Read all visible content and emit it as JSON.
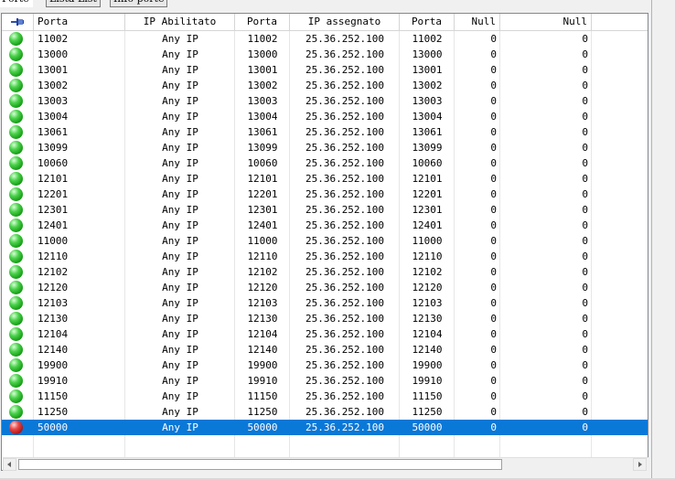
{
  "tabs": [
    {
      "label": "Porte",
      "selected": true
    },
    {
      "label": "Lista List",
      "selected": false
    },
    {
      "label": "Info porte",
      "selected": false
    }
  ],
  "columns": [
    {
      "key": "status",
      "label": ""
    },
    {
      "key": "porta",
      "label": "Porta"
    },
    {
      "key": "ip_abilitato",
      "label": "IP Abilitato"
    },
    {
      "key": "porta2",
      "label": "Porta"
    },
    {
      "key": "ip_assegnato",
      "label": "IP assegnato"
    },
    {
      "key": "porta3",
      "label": "Porta"
    },
    {
      "key": "null1",
      "label": "Null"
    },
    {
      "key": "null2",
      "label": "Null"
    }
  ],
  "header_icon": "pin-icon",
  "status_colors": {
    "active": "#1fb31f",
    "inactive": "#d01818"
  },
  "selection_color": "#0a78d7",
  "rows": [
    {
      "status": "active",
      "porta": "11002",
      "ip_abilitato": "Any IP",
      "porta2": "11002",
      "ip_assegnato": "25.36.252.100",
      "porta3": "11002",
      "null1": "0",
      "null2": "0"
    },
    {
      "status": "active",
      "porta": "13000",
      "ip_abilitato": "Any IP",
      "porta2": "13000",
      "ip_assegnato": "25.36.252.100",
      "porta3": "13000",
      "null1": "0",
      "null2": "0"
    },
    {
      "status": "active",
      "porta": "13001",
      "ip_abilitato": "Any IP",
      "porta2": "13001",
      "ip_assegnato": "25.36.252.100",
      "porta3": "13001",
      "null1": "0",
      "null2": "0"
    },
    {
      "status": "active",
      "porta": "13002",
      "ip_abilitato": "Any IP",
      "porta2": "13002",
      "ip_assegnato": "25.36.252.100",
      "porta3": "13002",
      "null1": "0",
      "null2": "0"
    },
    {
      "status": "active",
      "porta": "13003",
      "ip_abilitato": "Any IP",
      "porta2": "13003",
      "ip_assegnato": "25.36.252.100",
      "porta3": "13003",
      "null1": "0",
      "null2": "0"
    },
    {
      "status": "active",
      "porta": "13004",
      "ip_abilitato": "Any IP",
      "porta2": "13004",
      "ip_assegnato": "25.36.252.100",
      "porta3": "13004",
      "null1": "0",
      "null2": "0"
    },
    {
      "status": "active",
      "porta": "13061",
      "ip_abilitato": "Any IP",
      "porta2": "13061",
      "ip_assegnato": "25.36.252.100",
      "porta3": "13061",
      "null1": "0",
      "null2": "0"
    },
    {
      "status": "active",
      "porta": "13099",
      "ip_abilitato": "Any IP",
      "porta2": "13099",
      "ip_assegnato": "25.36.252.100",
      "porta3": "13099",
      "null1": "0",
      "null2": "0"
    },
    {
      "status": "active",
      "porta": "10060",
      "ip_abilitato": "Any IP",
      "porta2": "10060",
      "ip_assegnato": "25.36.252.100",
      "porta3": "10060",
      "null1": "0",
      "null2": "0"
    },
    {
      "status": "active",
      "porta": "12101",
      "ip_abilitato": "Any IP",
      "porta2": "12101",
      "ip_assegnato": "25.36.252.100",
      "porta3": "12101",
      "null1": "0",
      "null2": "0"
    },
    {
      "status": "active",
      "porta": "12201",
      "ip_abilitato": "Any IP",
      "porta2": "12201",
      "ip_assegnato": "25.36.252.100",
      "porta3": "12201",
      "null1": "0",
      "null2": "0"
    },
    {
      "status": "active",
      "porta": "12301",
      "ip_abilitato": "Any IP",
      "porta2": "12301",
      "ip_assegnato": "25.36.252.100",
      "porta3": "12301",
      "null1": "0",
      "null2": "0"
    },
    {
      "status": "active",
      "porta": "12401",
      "ip_abilitato": "Any IP",
      "porta2": "12401",
      "ip_assegnato": "25.36.252.100",
      "porta3": "12401",
      "null1": "0",
      "null2": "0"
    },
    {
      "status": "active",
      "porta": "11000",
      "ip_abilitato": "Any IP",
      "porta2": "11000",
      "ip_assegnato": "25.36.252.100",
      "porta3": "11000",
      "null1": "0",
      "null2": "0"
    },
    {
      "status": "active",
      "porta": "12110",
      "ip_abilitato": "Any IP",
      "porta2": "12110",
      "ip_assegnato": "25.36.252.100",
      "porta3": "12110",
      "null1": "0",
      "null2": "0"
    },
    {
      "status": "active",
      "porta": "12102",
      "ip_abilitato": "Any IP",
      "porta2": "12102",
      "ip_assegnato": "25.36.252.100",
      "porta3": "12102",
      "null1": "0",
      "null2": "0"
    },
    {
      "status": "active",
      "porta": "12120",
      "ip_abilitato": "Any IP",
      "porta2": "12120",
      "ip_assegnato": "25.36.252.100",
      "porta3": "12120",
      "null1": "0",
      "null2": "0"
    },
    {
      "status": "active",
      "porta": "12103",
      "ip_abilitato": "Any IP",
      "porta2": "12103",
      "ip_assegnato": "25.36.252.100",
      "porta3": "12103",
      "null1": "0",
      "null2": "0"
    },
    {
      "status": "active",
      "porta": "12130",
      "ip_abilitato": "Any IP",
      "porta2": "12130",
      "ip_assegnato": "25.36.252.100",
      "porta3": "12130",
      "null1": "0",
      "null2": "0"
    },
    {
      "status": "active",
      "porta": "12104",
      "ip_abilitato": "Any IP",
      "porta2": "12104",
      "ip_assegnato": "25.36.252.100",
      "porta3": "12104",
      "null1": "0",
      "null2": "0"
    },
    {
      "status": "active",
      "porta": "12140",
      "ip_abilitato": "Any IP",
      "porta2": "12140",
      "ip_assegnato": "25.36.252.100",
      "porta3": "12140",
      "null1": "0",
      "null2": "0"
    },
    {
      "status": "active",
      "porta": "19900",
      "ip_abilitato": "Any IP",
      "porta2": "19900",
      "ip_assegnato": "25.36.252.100",
      "porta3": "19900",
      "null1": "0",
      "null2": "0"
    },
    {
      "status": "active",
      "porta": "19910",
      "ip_abilitato": "Any IP",
      "porta2": "19910",
      "ip_assegnato": "25.36.252.100",
      "porta3": "19910",
      "null1": "0",
      "null2": "0"
    },
    {
      "status": "active",
      "porta": "11150",
      "ip_abilitato": "Any IP",
      "porta2": "11150",
      "ip_assegnato": "25.36.252.100",
      "porta3": "11150",
      "null1": "0",
      "null2": "0"
    },
    {
      "status": "active",
      "porta": "11250",
      "ip_abilitato": "Any IP",
      "porta2": "11250",
      "ip_assegnato": "25.36.252.100",
      "porta3": "11250",
      "null1": "0",
      "null2": "0"
    },
    {
      "status": "inactive",
      "selected": true,
      "porta": "50000",
      "ip_abilitato": "Any IP",
      "porta2": "50000",
      "ip_assegnato": "25.36.252.100",
      "porta3": "50000",
      "null1": "0",
      "null2": "0"
    }
  ],
  "scrollbar": {
    "left_arrow": "◀",
    "right_arrow": "▶"
  }
}
